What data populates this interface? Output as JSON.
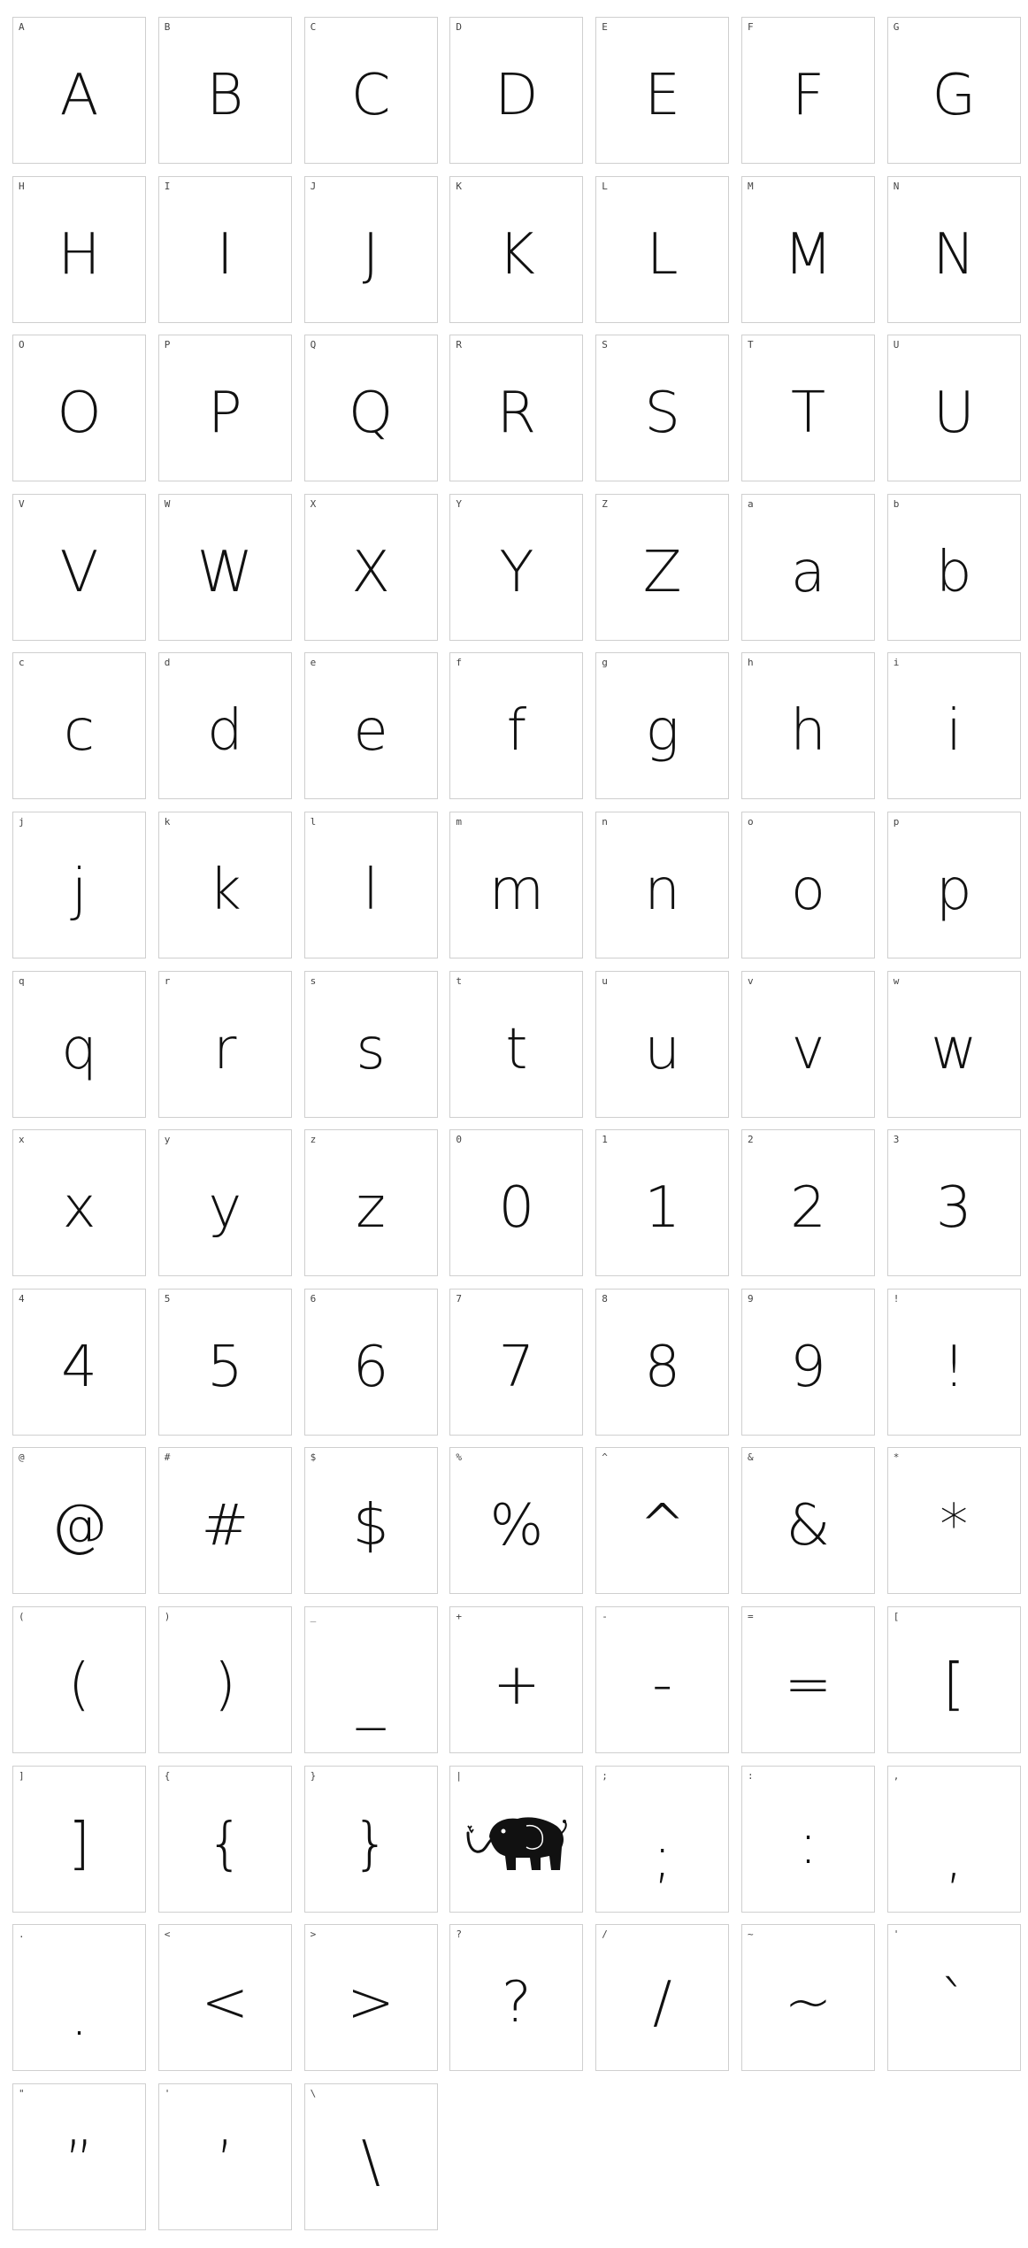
{
  "glyphs": [
    {
      "label": "A",
      "char": "A"
    },
    {
      "label": "B",
      "char": "B"
    },
    {
      "label": "C",
      "char": "C"
    },
    {
      "label": "D",
      "char": "D"
    },
    {
      "label": "E",
      "char": "E"
    },
    {
      "label": "F",
      "char": "F"
    },
    {
      "label": "G",
      "char": "G"
    },
    {
      "label": "H",
      "char": "H"
    },
    {
      "label": "I",
      "char": "I"
    },
    {
      "label": "J",
      "char": "J"
    },
    {
      "label": "K",
      "char": "K"
    },
    {
      "label": "L",
      "char": "L"
    },
    {
      "label": "M",
      "char": "M"
    },
    {
      "label": "N",
      "char": "N"
    },
    {
      "label": "O",
      "char": "O"
    },
    {
      "label": "P",
      "char": "P"
    },
    {
      "label": "Q",
      "char": "Q"
    },
    {
      "label": "R",
      "char": "R"
    },
    {
      "label": "S",
      "char": "S"
    },
    {
      "label": "T",
      "char": "T"
    },
    {
      "label": "U",
      "char": "U"
    },
    {
      "label": "V",
      "char": "V"
    },
    {
      "label": "W",
      "char": "W"
    },
    {
      "label": "X",
      "char": "X"
    },
    {
      "label": "Y",
      "char": "Y"
    },
    {
      "label": "Z",
      "char": "Z"
    },
    {
      "label": "a",
      "char": "a"
    },
    {
      "label": "b",
      "char": "b"
    },
    {
      "label": "c",
      "char": "c"
    },
    {
      "label": "d",
      "char": "d"
    },
    {
      "label": "e",
      "char": "e"
    },
    {
      "label": "f",
      "char": "f"
    },
    {
      "label": "g",
      "char": "g"
    },
    {
      "label": "h",
      "char": "h"
    },
    {
      "label": "i",
      "char": "i"
    },
    {
      "label": "j",
      "char": "j"
    },
    {
      "label": "k",
      "char": "k"
    },
    {
      "label": "l",
      "char": "l"
    },
    {
      "label": "m",
      "char": "m"
    },
    {
      "label": "n",
      "char": "n"
    },
    {
      "label": "o",
      "char": "o"
    },
    {
      "label": "p",
      "char": "p"
    },
    {
      "label": "q",
      "char": "q"
    },
    {
      "label": "r",
      "char": "r"
    },
    {
      "label": "s",
      "char": "s"
    },
    {
      "label": "t",
      "char": "t"
    },
    {
      "label": "u",
      "char": "u"
    },
    {
      "label": "v",
      "char": "v"
    },
    {
      "label": "w",
      "char": "w"
    },
    {
      "label": "x",
      "char": "x"
    },
    {
      "label": "y",
      "char": "y"
    },
    {
      "label": "z",
      "char": "z"
    },
    {
      "label": "0",
      "char": "0"
    },
    {
      "label": "1",
      "char": "1"
    },
    {
      "label": "2",
      "char": "2"
    },
    {
      "label": "3",
      "char": "3"
    },
    {
      "label": "4",
      "char": "4"
    },
    {
      "label": "5",
      "char": "5"
    },
    {
      "label": "6",
      "char": "6"
    },
    {
      "label": "7",
      "char": "7"
    },
    {
      "label": "8",
      "char": "8"
    },
    {
      "label": "9",
      "char": "9"
    },
    {
      "label": "!",
      "char": "!"
    },
    {
      "label": "@",
      "char": "@"
    },
    {
      "label": "#",
      "char": "#"
    },
    {
      "label": "$",
      "char": "$"
    },
    {
      "label": "%",
      "char": "%"
    },
    {
      "label": "^",
      "char": "^"
    },
    {
      "label": "&",
      "char": "&"
    },
    {
      "label": "*",
      "char": "*"
    },
    {
      "label": "(",
      "char": "("
    },
    {
      "label": ")",
      "char": ")"
    },
    {
      "label": "_",
      "char": "_"
    },
    {
      "label": "+",
      "char": "+"
    },
    {
      "label": "-",
      "char": "-"
    },
    {
      "label": "=",
      "char": "="
    },
    {
      "label": "[",
      "char": "["
    },
    {
      "label": "]",
      "char": "]"
    },
    {
      "label": "{",
      "char": "{"
    },
    {
      "label": "}",
      "char": "}"
    },
    {
      "label": "|",
      "char": "",
      "icon": "elephant-icon"
    },
    {
      "label": ";",
      "char": ";"
    },
    {
      "label": ":",
      "char": ":"
    },
    {
      "label": ",",
      "char": ","
    },
    {
      "label": ".",
      "char": "."
    },
    {
      "label": "<",
      "char": "<"
    },
    {
      "label": ">",
      "char": ">"
    },
    {
      "label": "?",
      "char": "?"
    },
    {
      "label": "/",
      "char": "/"
    },
    {
      "label": "~",
      "char": "~"
    },
    {
      "label": "'",
      "char": "`"
    },
    {
      "label": "\"",
      "char": "”"
    },
    {
      "label": "'",
      "char": "’"
    },
    {
      "label": "\\",
      "char": "\\"
    }
  ],
  "colors": {
    "border": "#cfcfcf",
    "glyph": "#111111",
    "label": "#444444",
    "background": "#ffffff"
  }
}
